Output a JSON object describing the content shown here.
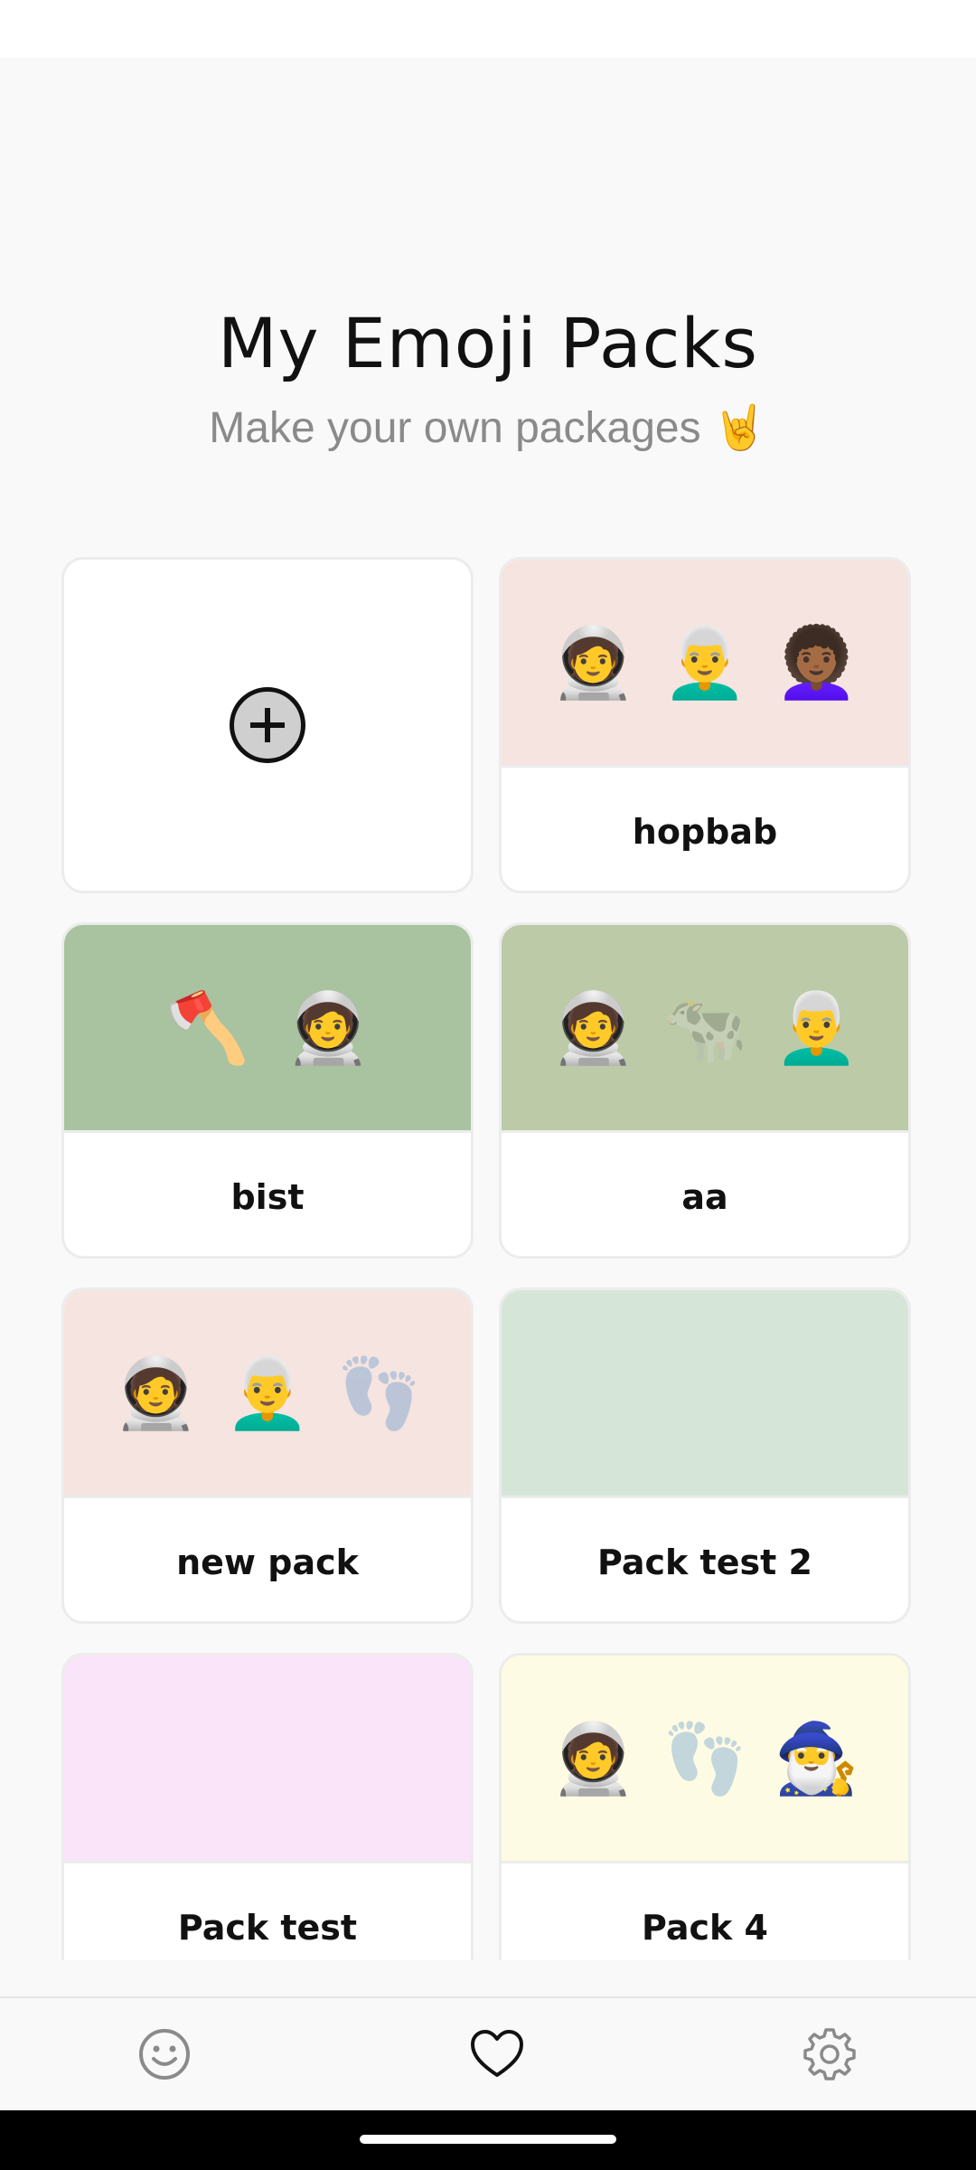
{
  "header": {
    "title": "My Emoji Packs",
    "subtitle": "Make your own packages 🤘"
  },
  "add_pack": {
    "icon": "plus-circle-icon"
  },
  "packs": [
    {
      "name": "hopbab",
      "bg": "#f5e4df",
      "emojis": [
        "🧑‍🚀",
        "👨‍🦳",
        "👩🏾‍🦱"
      ],
      "faded": [
        false,
        false,
        false
      ]
    },
    {
      "name": "bist",
      "bg": "#a9c29f",
      "emojis": [
        "🪓",
        "🧑‍🚀"
      ],
      "faded": [
        false,
        false
      ]
    },
    {
      "name": "aa",
      "bg": "#bccaa8",
      "emojis": [
        "🧑‍🚀",
        "🐄",
        "👨‍🦳"
      ],
      "faded": [
        false,
        true,
        false
      ]
    },
    {
      "name": "new pack",
      "bg": "#f5e4df",
      "emojis": [
        "🧑‍🚀",
        "👨‍🦳",
        "👣"
      ],
      "faded": [
        false,
        false,
        true
      ]
    },
    {
      "name": "Pack test 2",
      "bg": "#d5e6d9",
      "emojis": [],
      "faded": []
    },
    {
      "name": "Pack test",
      "bg": "#f9e4f9",
      "emojis": [],
      "faded": []
    },
    {
      "name": "Pack 4",
      "bg": "#fdfbe3",
      "emojis": [
        "🧑‍🚀",
        "👣",
        "🧙‍♂️"
      ],
      "faded": [
        false,
        true,
        false
      ]
    }
  ],
  "nav": {
    "items": [
      {
        "icon": "smiley-icon"
      },
      {
        "icon": "heart-icon"
      },
      {
        "icon": "gear-icon"
      }
    ],
    "active_color": "#111111",
    "inactive_color": "#8a8a8a"
  }
}
